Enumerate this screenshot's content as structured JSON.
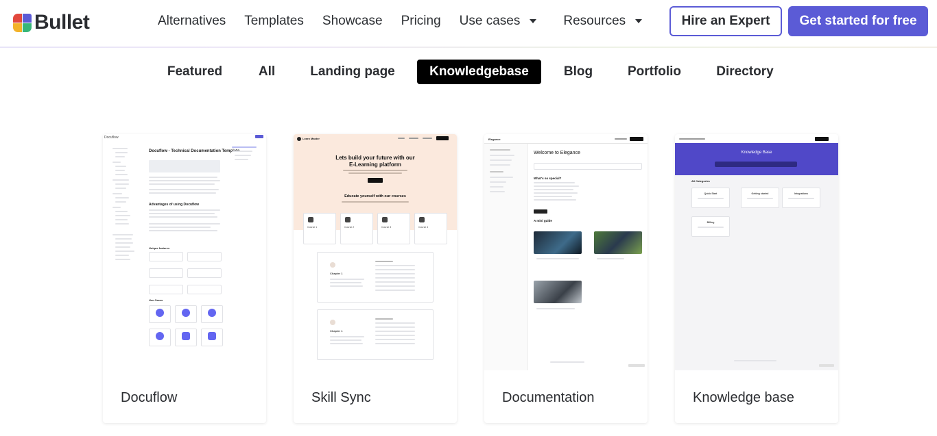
{
  "header": {
    "logo_text": "Bullet",
    "nav": [
      "Alternatives",
      "Templates",
      "Showcase",
      "Pricing",
      "Use cases",
      "Resources"
    ],
    "hire_label": "Hire an Expert",
    "cta_label": "Get started for free"
  },
  "tabs": [
    "Featured",
    "All",
    "Landing page",
    "Knowledgebase",
    "Blog",
    "Portfolio",
    "Directory"
  ],
  "active_tab": "Knowledgebase",
  "cards": [
    {
      "title": "Docuflow",
      "thumb": {
        "brand": "Docuflow",
        "heading": "Docuflow - Technical Documentation Template",
        "section1": "Advantages of using Docuflow",
        "section2": "Unique features",
        "section3": "Use Cases"
      }
    },
    {
      "title": "Skill Sync",
      "thumb": {
        "brand": "Learn Master",
        "hero_line1": "Lets build your future with our",
        "hero_line2": "E-Learning platform",
        "subhead": "Educate yourself with our courses",
        "courses": [
          "Course 1",
          "Course 2",
          "Course 3",
          "Course 4"
        ],
        "chapter": "Chapter 1"
      }
    },
    {
      "title": "Documentation",
      "thumb": {
        "brand": "Elegance",
        "heading": "Welcome to Elegance",
        "section1": "What's so special?",
        "section2": "A mini guide"
      }
    },
    {
      "title": "Knowledge base",
      "thumb": {
        "hero_title": "Knowledge Base",
        "categories_label": "All Categories",
        "categories": [
          "Quick Start",
          "Getting started",
          "Integrations",
          "Billing"
        ]
      }
    }
  ]
}
